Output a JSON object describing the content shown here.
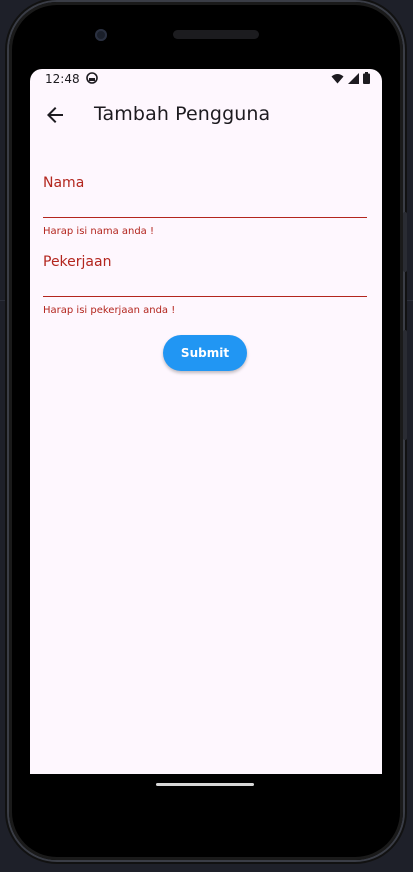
{
  "status_bar": {
    "time": "12:48"
  },
  "app_bar": {
    "title": "Tambah Pengguna"
  },
  "form": {
    "name_field": {
      "label": "Nama",
      "value": "",
      "error": "Harap isi nama anda !"
    },
    "job_field": {
      "label": "Pekerjaan",
      "value": "",
      "error": "Harap isi pekerjaan anda !"
    },
    "submit_label": "Submit"
  },
  "colors": {
    "error": "#b3261e",
    "primary_button": "#2196f3",
    "screen_background": "#fef7fe"
  },
  "icons": {
    "back": "arrow-back-icon",
    "status_app": "android-icon",
    "wifi": "wifi-icon",
    "signal": "signal-icon",
    "battery": "battery-icon"
  }
}
